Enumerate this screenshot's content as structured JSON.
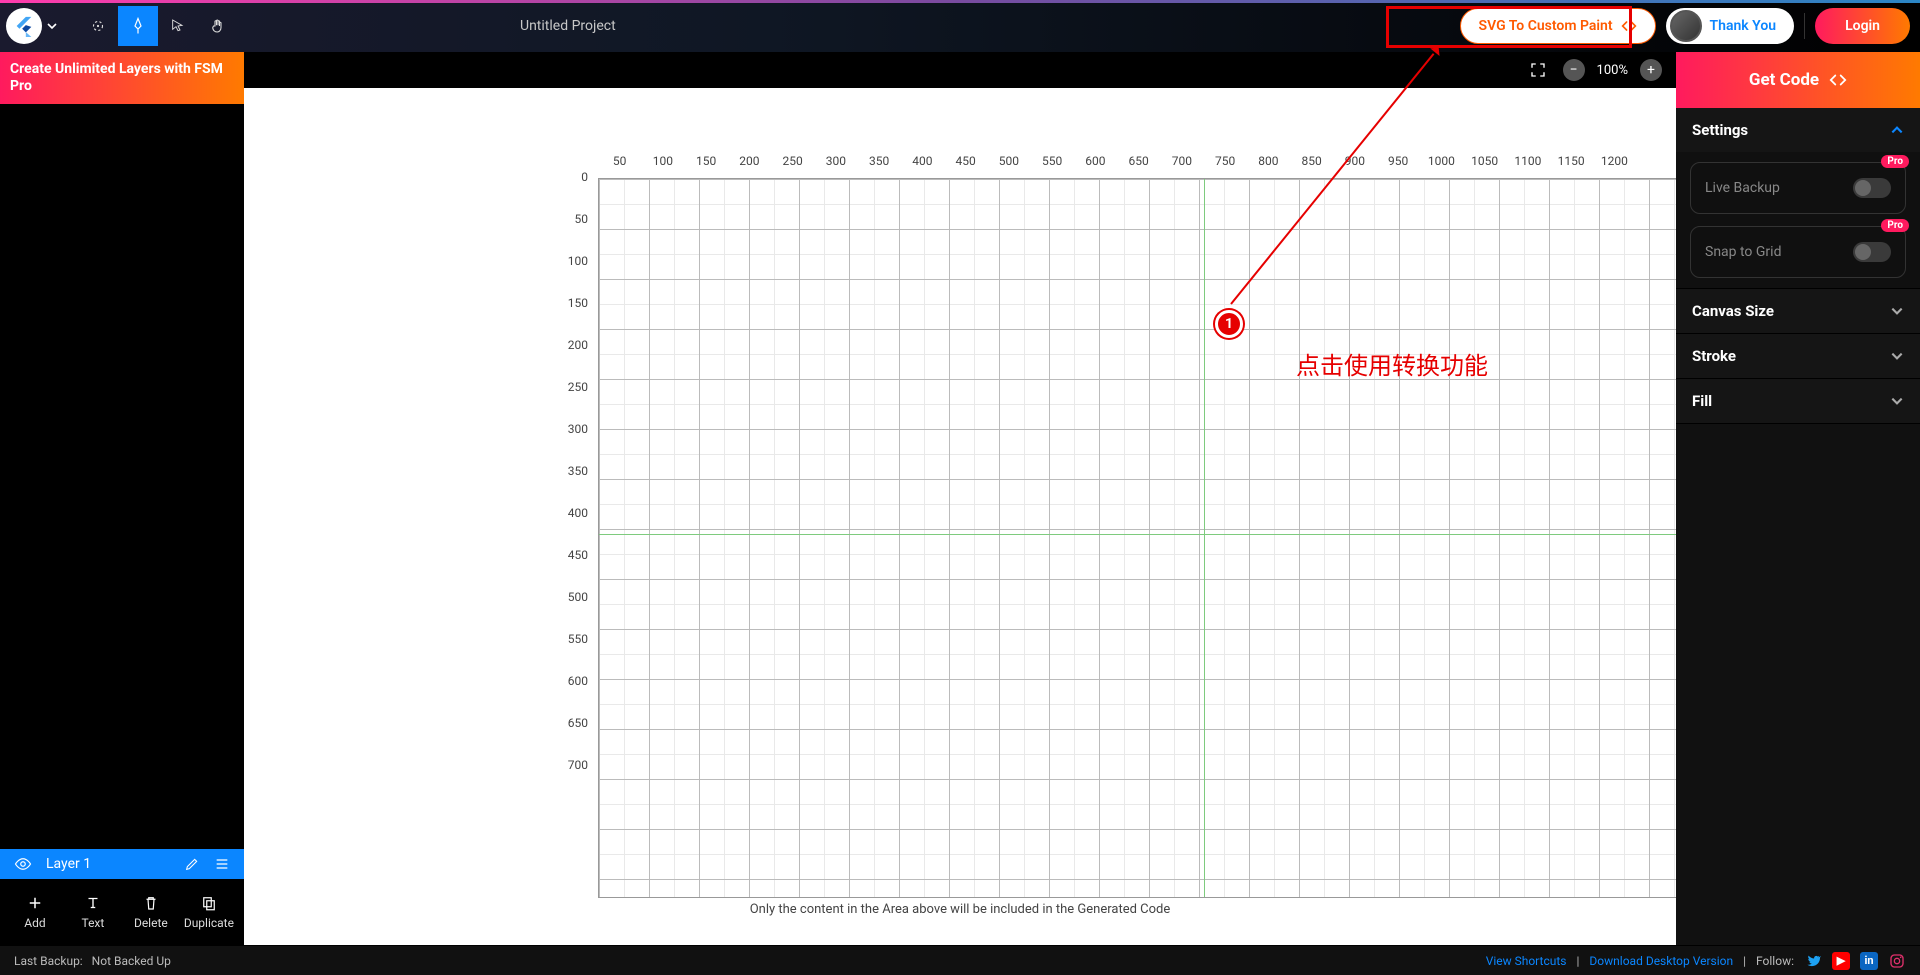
{
  "topbar": {
    "project_title": "Untitled Project",
    "svg_button": "SVG To Custom Paint",
    "thank_you": "Thank You",
    "login": "Login"
  },
  "promo": {
    "text": "Create Unlimited Layers with FSM Pro"
  },
  "canvas": {
    "zoom": "100%",
    "caption": "Only the content in the Area above will be included in the Generated Code",
    "ruler_x": [
      "50",
      "100",
      "150",
      "200",
      "250",
      "300",
      "350",
      "400",
      "450",
      "500",
      "550",
      "600",
      "650",
      "700",
      "750",
      "800",
      "850",
      "900",
      "950",
      "1000",
      "1050",
      "1100",
      "1150",
      "1200"
    ],
    "ruler_y": [
      "0",
      "50",
      "100",
      "150",
      "200",
      "250",
      "300",
      "350",
      "400",
      "450",
      "500",
      "550",
      "600",
      "650",
      "700"
    ]
  },
  "annotation": {
    "marker": "1",
    "text": "点击使用转换功能"
  },
  "right": {
    "getcode": "Get Code",
    "settings": "Settings",
    "live_backup": "Live Backup",
    "snap_grid": "Snap to Grid",
    "pro": "Pro",
    "canvas_size": "Canvas Size",
    "stroke": "Stroke",
    "fill": "Fill"
  },
  "layers": {
    "name": "Layer 1",
    "add": "Add",
    "text": "Text",
    "delete": "Delete",
    "dup": "Duplicate"
  },
  "footer": {
    "backup_label": "Last Backup:",
    "backup_value": "Not Backed Up",
    "shortcuts": "View Shortcuts",
    "download": "Download Desktop Version",
    "follow": "Follow:"
  }
}
